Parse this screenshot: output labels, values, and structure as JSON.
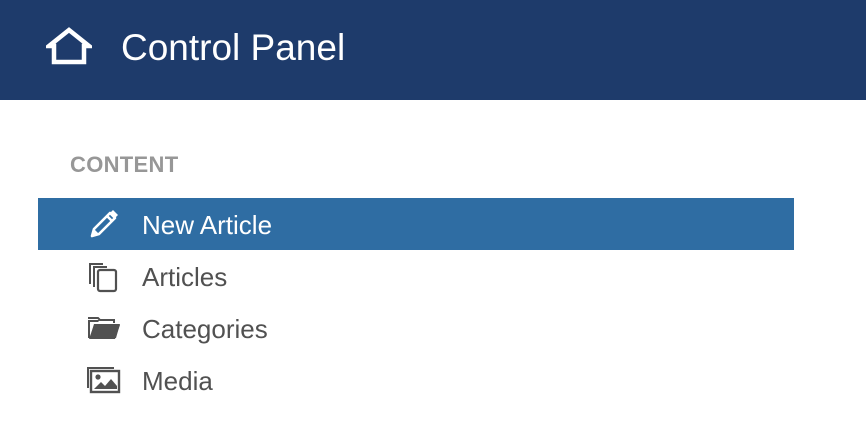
{
  "header": {
    "title": "Control Panel",
    "icon": "home-icon",
    "background": "#1e3b6b"
  },
  "section": {
    "heading": "CONTENT"
  },
  "menu": {
    "items": [
      {
        "label": "New Article",
        "icon": "pencil-icon",
        "active": true
      },
      {
        "label": "Articles",
        "icon": "copy-icon",
        "active": false
      },
      {
        "label": "Categories",
        "icon": "folder-open-icon",
        "active": false
      },
      {
        "label": "Media",
        "icon": "images-icon",
        "active": false
      }
    ],
    "active_color": "#2f6da3"
  }
}
